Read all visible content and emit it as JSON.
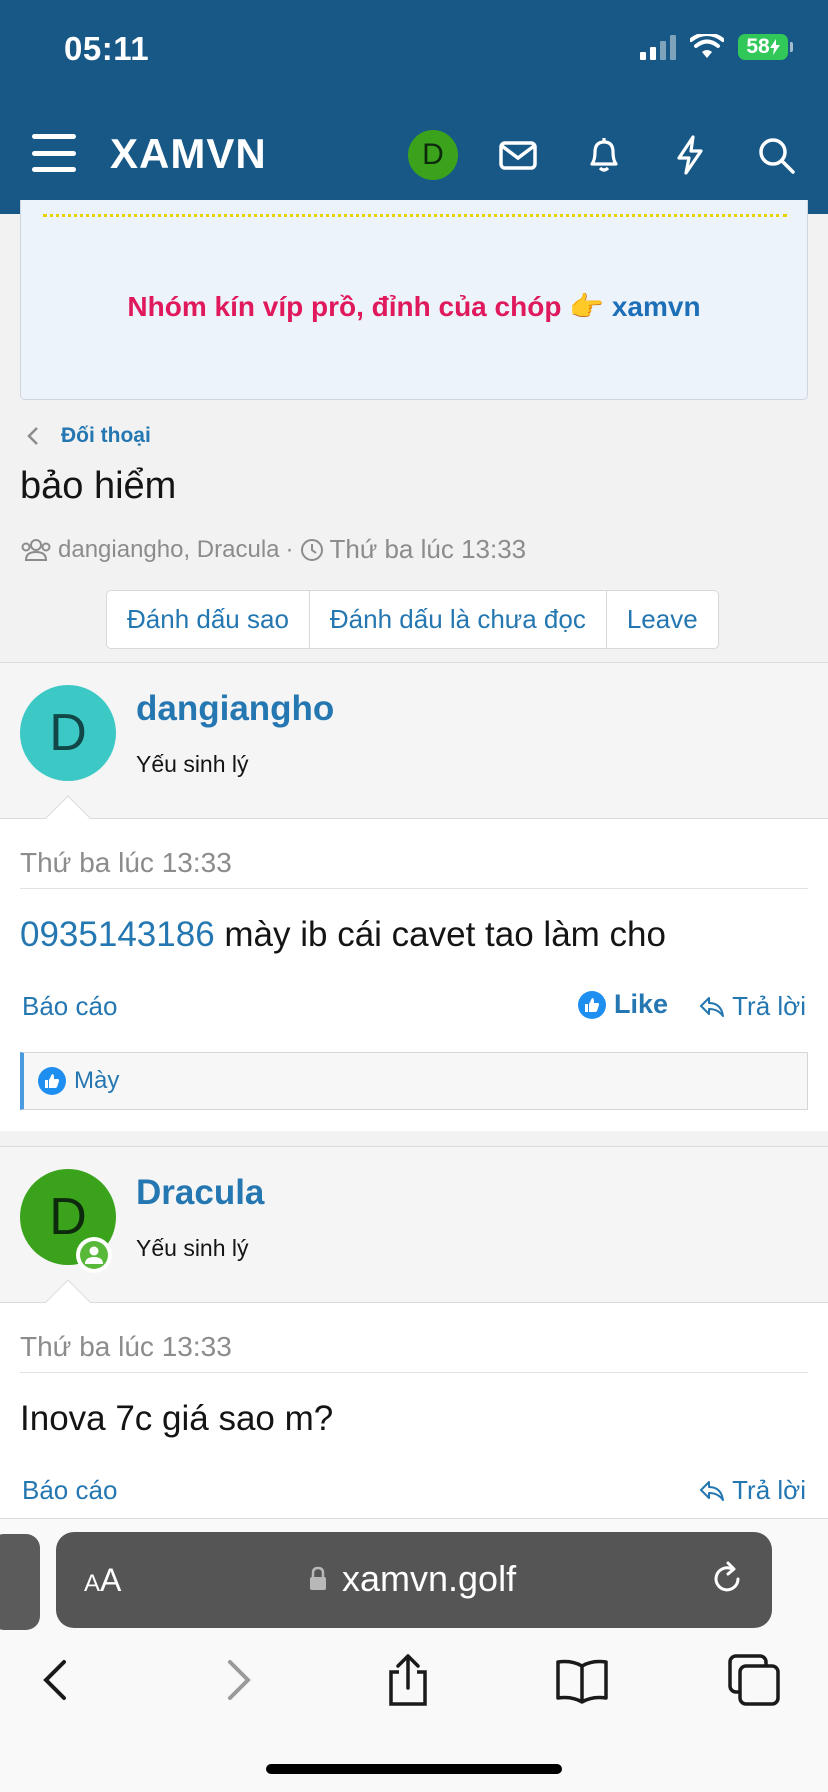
{
  "status_bar": {
    "time": "05:11",
    "battery": "58"
  },
  "header": {
    "logo": "XAMVN",
    "avatar_letter": "D"
  },
  "banner": {
    "text": "Nhóm kín víp prồ, đỉnh của chóp",
    "emoji": "👉",
    "link": "xamvn"
  },
  "breadcrumb": "Đối thoại",
  "conversation": {
    "title": "bảo hiểm",
    "participants": "dangiangho, Dracula",
    "separator": "·",
    "time": "Thứ ba lúc 13:33",
    "buttons": [
      "Đánh dấu sao",
      "Đánh dấu là chưa đọc",
      "Leave"
    ]
  },
  "messages": [
    {
      "avatar_letter": "D",
      "author": "dangiangho",
      "user_title": "Yếu sinh lý",
      "date": "Thứ ba lúc 13:33",
      "phone": "0935143186",
      "text": " mày ib cái cavet tao làm cho",
      "report": "Báo cáo",
      "like": "Like",
      "reply": "Trả lời",
      "reaction_user": "Mày"
    },
    {
      "avatar_letter": "D",
      "author": "Dracula",
      "user_title": "Yếu sinh lý",
      "date": "Thứ ba lúc 13:33",
      "text": "Inova 7c giá sao m?",
      "report": "Báo cáo",
      "reply": "Trả lời"
    }
  ],
  "browser": {
    "aa_big": "A",
    "aa_small": "A",
    "url": "xamvn.golf"
  },
  "colors": {
    "header": "#185886",
    "link": "#2577b1",
    "accent": "#e0195c",
    "avatar1": "#3cc9c6",
    "avatar2": "#3aa31b"
  }
}
